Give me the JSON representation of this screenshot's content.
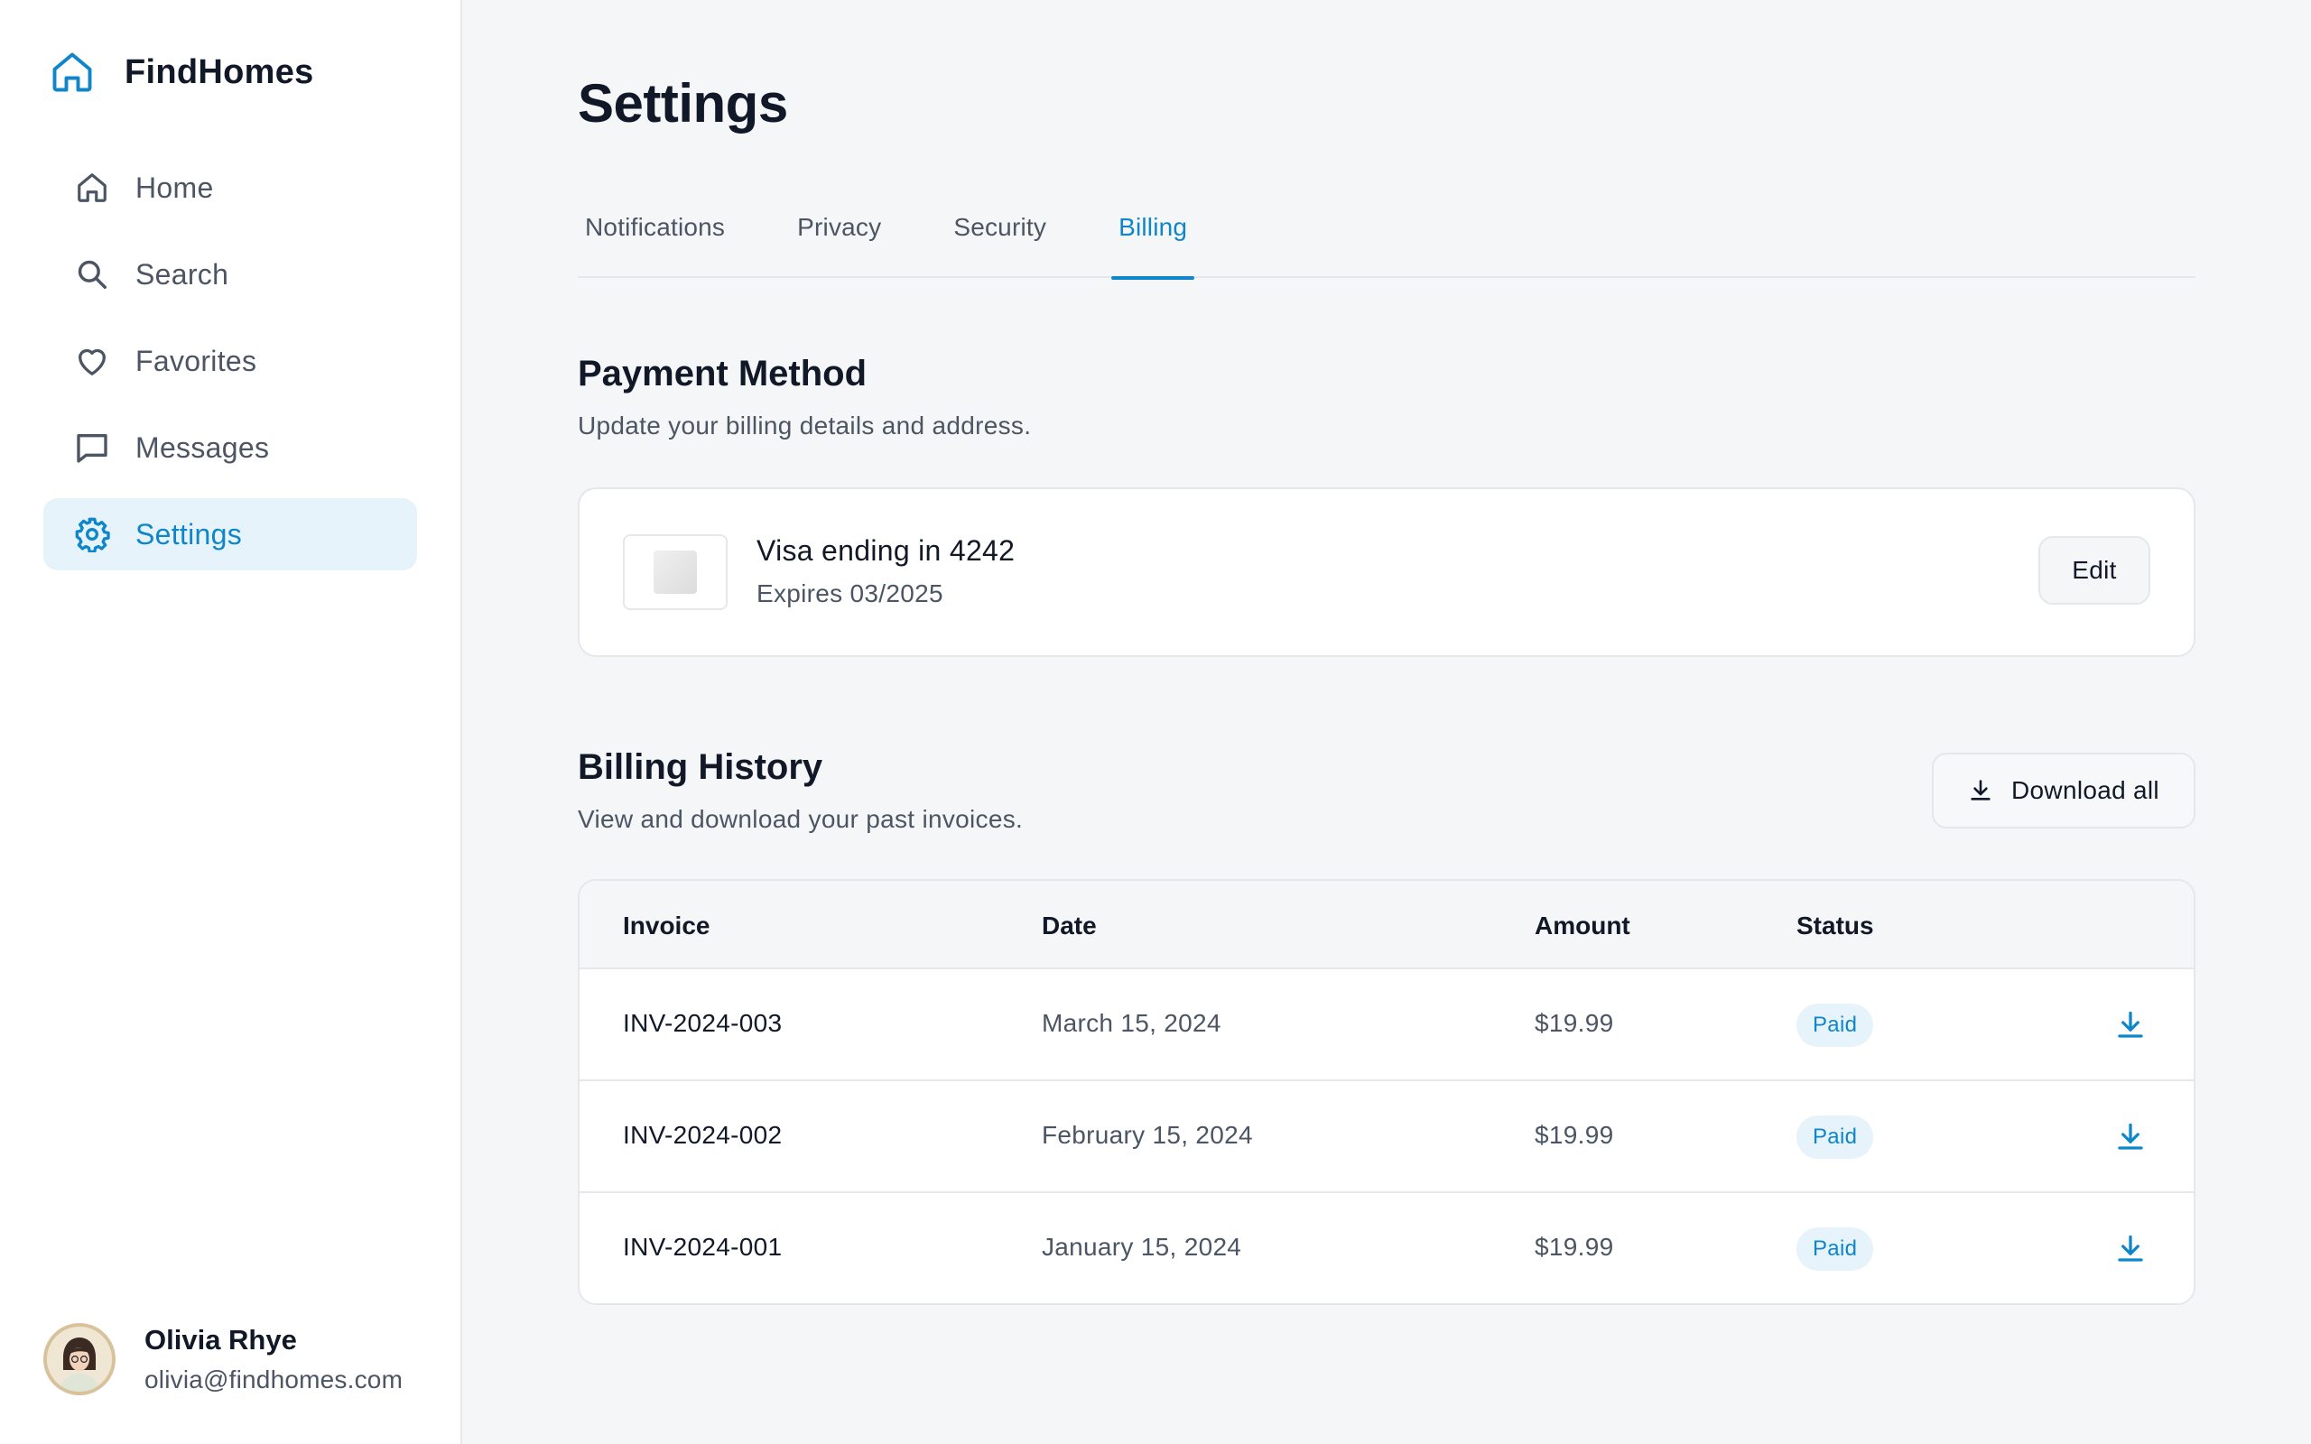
{
  "brand": {
    "name": "FindHomes",
    "icon": "home-outline-icon",
    "accent": "#0e86c9"
  },
  "sidebar": {
    "items": [
      {
        "label": "Home",
        "icon": "home-icon",
        "active": false
      },
      {
        "label": "Search",
        "icon": "search-icon",
        "active": false
      },
      {
        "label": "Favorites",
        "icon": "heart-icon",
        "active": false
      },
      {
        "label": "Messages",
        "icon": "message-icon",
        "active": false
      },
      {
        "label": "Settings",
        "icon": "gear-icon",
        "active": true
      }
    ]
  },
  "user": {
    "name": "Olivia Rhye",
    "email": "olivia@findhomes.com"
  },
  "page": {
    "title": "Settings"
  },
  "tabs": [
    {
      "label": "Notifications",
      "active": false
    },
    {
      "label": "Privacy",
      "active": false
    },
    {
      "label": "Security",
      "active": false
    },
    {
      "label": "Billing",
      "active": true
    }
  ],
  "payment": {
    "title": "Payment Method",
    "subtitle": "Update your billing details and address.",
    "card_label": "Visa ending in 4242",
    "card_expiry": "Expires 03/2025",
    "edit_label": "Edit"
  },
  "history": {
    "title": "Billing History",
    "subtitle": "View and download your past invoices.",
    "download_all_label": "Download all",
    "columns": {
      "invoice": "Invoice",
      "date": "Date",
      "amount": "Amount",
      "status": "Status"
    },
    "rows": [
      {
        "invoice": "INV-2024-003",
        "date": "March 15, 2024",
        "amount": "$19.99",
        "status": "Paid"
      },
      {
        "invoice": "INV-2024-002",
        "date": "February 15, 2024",
        "amount": "$19.99",
        "status": "Paid"
      },
      {
        "invoice": "INV-2024-001",
        "date": "January 15, 2024",
        "amount": "$19.99",
        "status": "Paid"
      }
    ]
  },
  "colors": {
    "accent": "#0e86c9",
    "active_bg": "#e6f3fb",
    "text": "#111827",
    "muted": "#4b5563",
    "border": "#e5e7eb"
  }
}
